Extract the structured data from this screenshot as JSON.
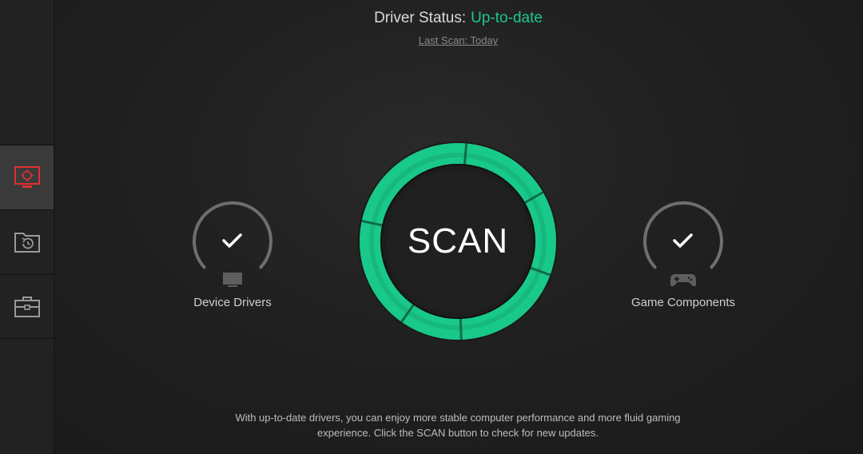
{
  "header": {
    "status_label": "Driver Status:",
    "status_value": "Up-to-date",
    "last_scan": "Last Scan: Today"
  },
  "sidebar": {
    "items": [
      {
        "icon": "monitor-scan-icon",
        "active": true
      },
      {
        "icon": "restore-folder-icon",
        "active": false
      },
      {
        "icon": "toolbox-icon",
        "active": false
      }
    ]
  },
  "gauges": {
    "device_drivers": {
      "label": "Device Drivers",
      "icon": "monitor-icon",
      "status": "checkmark-icon"
    },
    "game_components": {
      "label": "Game Components",
      "icon": "gamepad-icon",
      "status": "checkmark-icon"
    }
  },
  "scan": {
    "label": "SCAN"
  },
  "footer": {
    "line1": "With up-to-date drivers, you can enjoy more stable computer performance and more fluid gaming",
    "line2": "experience. Click the SCAN button to check for new updates."
  },
  "colors": {
    "accent_green": "#1ec98a",
    "active_icon_red": "#e03030",
    "background": "#1b1b1b"
  }
}
